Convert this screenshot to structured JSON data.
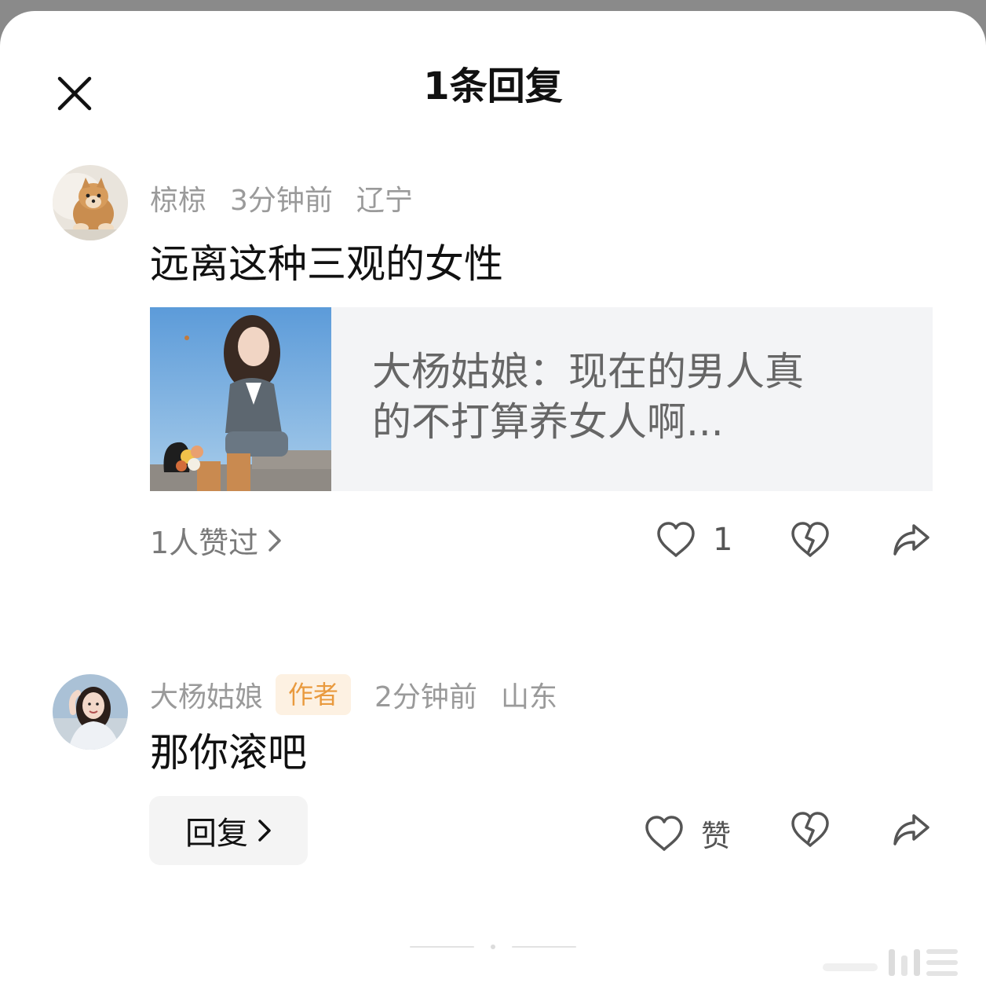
{
  "sheet": {
    "title": "1条回复"
  },
  "comment": {
    "username": "椋椋",
    "time": "3分钟前",
    "location": "辽宁",
    "text": "远离这种三观的女性",
    "article": {
      "text": "大杨姑娘：现在的男人真的不打算养女人啊..."
    },
    "liked_by": "1人赞过",
    "like_count": "1"
  },
  "reply": {
    "username": "大杨姑娘",
    "badge": "作者",
    "time": "2分钟前",
    "location": "山东",
    "text": "那你滚吧",
    "reply_button": "回复",
    "like_label": "赞"
  },
  "icons": {
    "close": "close-icon",
    "heart": "heart-icon",
    "broken_heart": "broken-heart-icon",
    "share": "share-icon",
    "chevron": "chevron-right-icon"
  },
  "colors": {
    "badge_bg": "#fdf1e2",
    "badge_text": "#e99a3e",
    "meta_text": "#9a9a9a",
    "card_bg": "#f3f4f6"
  }
}
